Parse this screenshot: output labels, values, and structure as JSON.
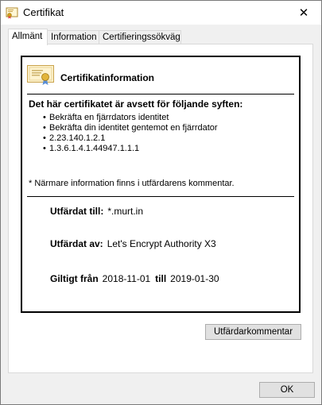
{
  "window": {
    "title": "Certifikat",
    "close_glyph": "✕"
  },
  "tabs": [
    {
      "label": "Allmänt",
      "active": true
    },
    {
      "label": "Information",
      "active": false
    },
    {
      "label": "Certifieringssökväg",
      "active": false
    }
  ],
  "info": {
    "heading": "Certifikatinformation",
    "purpose_heading": "Det här certifikatet är avsett för följande syften:",
    "purposes": [
      "Bekräfta en fjärrdators identitet",
      "Bekräfta din identitet gentemot en fjärrdator",
      "2.23.140.1.2.1",
      "1.3.6.1.4.1.44947.1.1.1"
    ],
    "footnote": "* Närmare information finns i utfärdarens kommentar.",
    "issued_to_label": "Utfärdat till:",
    "issued_to_value": "*.murt.in",
    "issued_by_label": "Utfärdat av:",
    "issued_by_value": "Let's Encrypt Authority X3",
    "valid_from_label": "Giltigt från",
    "valid_from_value": "2018-11-01",
    "valid_to_label": "till",
    "valid_to_value": "2019-01-30"
  },
  "buttons": {
    "issuer_statement": "Utfärdarkommentar",
    "ok": "OK"
  },
  "icons": {
    "title": "certificate-icon",
    "info": "certificate-icon",
    "close": "close-icon"
  }
}
